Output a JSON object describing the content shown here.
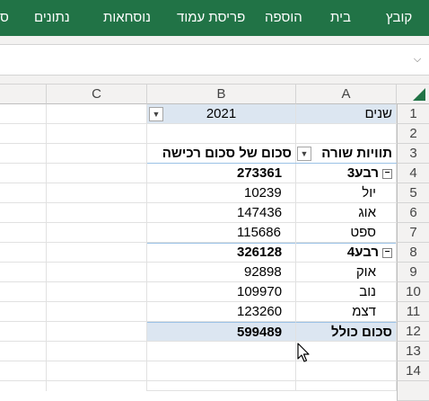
{
  "ribbon": {
    "tabs": [
      "קובץ",
      "בית",
      "הוספה",
      "פריסת עמוד",
      "נוסחאות",
      "נתונים",
      "ס"
    ]
  },
  "columns": [
    "A",
    "B",
    "C"
  ],
  "rows": [
    "1",
    "2",
    "3",
    "4",
    "5",
    "6",
    "7",
    "8",
    "9",
    "10",
    "11",
    "12",
    "13",
    "14"
  ],
  "pivot": {
    "filter_label": "שנים",
    "filter_value": "2021",
    "row_labels_header": "תוויות שורה",
    "value_header": "סכום של סכום רכישה",
    "groups": [
      {
        "label": "רבע3",
        "total": "273361",
        "items": [
          {
            "label": "יול",
            "value": "10239"
          },
          {
            "label": "אוג",
            "value": "147436"
          },
          {
            "label": "ספט",
            "value": "115686"
          }
        ]
      },
      {
        "label": "רבע4",
        "total": "326128",
        "items": [
          {
            "label": "אוק",
            "value": "92898"
          },
          {
            "label": "נוב",
            "value": "109970"
          },
          {
            "label": "דצמ",
            "value": "123260"
          }
        ]
      }
    ],
    "grand_total_label": "סכום כולל",
    "grand_total_value": "599489"
  },
  "icons": {
    "filter": "filter-icon",
    "dropdown": "dropdown-arrow-icon",
    "collapse": "collapse-minus-icon",
    "chevron": "chevron-down-icon"
  },
  "colors": {
    "ribbon": "#217346",
    "pivot_header_fill": "#dce6f1"
  }
}
